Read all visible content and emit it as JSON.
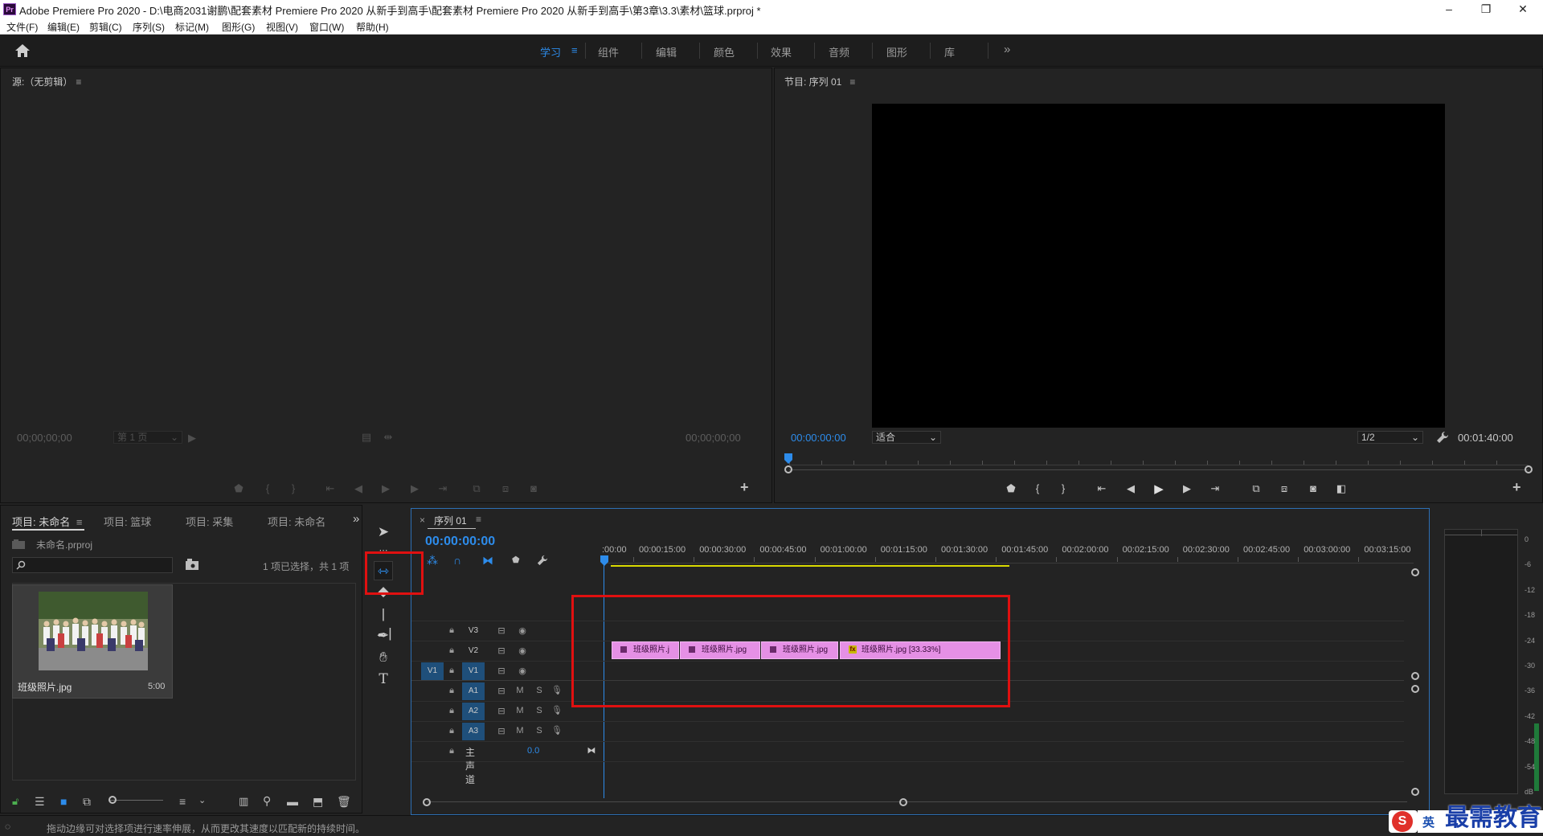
{
  "window": {
    "logo": "Pr",
    "title": "Adobe Premiere Pro 2020 - D:\\电商2031谢鹏\\配套素材 Premiere Pro 2020 从新手到高手\\配套素材 Premiere Pro 2020 从新手到高手\\第3章\\3.3\\素材\\篮球.prproj *",
    "minimize": "–",
    "restore": "❐",
    "close": "✕"
  },
  "menu": [
    "文件(F)",
    "编辑(E)",
    "剪辑(C)",
    "序列(S)",
    "标记(M)",
    "图形(G)",
    "视图(V)",
    "窗口(W)",
    "帮助(H)"
  ],
  "workspaces": {
    "items": [
      "学习",
      "组件",
      "编辑",
      "颜色",
      "效果",
      "音频",
      "图形",
      "库"
    ],
    "active": "学习",
    "menu_glyph": "≡",
    "more": "»"
  },
  "source": {
    "title": "源:（无剪辑）",
    "menu_glyph": "≡",
    "timecode_left": "00;00;00;00",
    "page_select": "第 1 页",
    "timecode_right": "00;00;00;00"
  },
  "program": {
    "title": "节目: 序列 01",
    "menu_glyph": "≡",
    "timecode": "00:00:00:00",
    "fit": "适合",
    "resolution": "1/2",
    "duration": "00:01:40:00"
  },
  "project": {
    "tabs": [
      "项目: 未命名",
      "项目: 篮球",
      "项目: 采集",
      "项目: 未命名"
    ],
    "menu_glyph": "≡",
    "more": "»",
    "file": "未命名.prproj",
    "selection_info": "1 项已选择，共 1 项",
    "item_name": "班级照片.jpg",
    "item_duration": "5:00"
  },
  "timeline": {
    "tab_close": "×",
    "title": "序列 01",
    "menu_glyph": "≡",
    "timecode": "00:00:00:00",
    "ruler": ":00:00",
    "ruler_labels": [
      "00:00:15:00",
      "00:00:30:00",
      "00:00:45:00",
      "00:01:00:00",
      "00:01:15:00",
      "00:01:30:00",
      "00:01:45:00",
      "00:02:00:00",
      "00:02:15:00",
      "00:02:30:00",
      "00:02:45:00",
      "00:03:00:00",
      "00:03:15:00"
    ],
    "video_tracks": [
      "V3",
      "V2",
      "V1"
    ],
    "source_patch_v": "V1",
    "audio_tracks": [
      "A1",
      "A2",
      "A3"
    ],
    "mute": "M",
    "solo": "S",
    "master": "主声道",
    "master_value": "0.0",
    "clips": [
      {
        "label": "班级照片.j"
      },
      {
        "label": "班级照片.jpg"
      },
      {
        "label": "班级照片.jpg"
      },
      {
        "label": "班级照片.jpg [33.33%]"
      }
    ]
  },
  "meter": {
    "scale": [
      "0",
      "-6",
      "-12",
      "-18",
      "-24",
      "-30",
      "-36",
      "-42",
      "-48",
      "-54",
      "dB"
    ]
  },
  "status": {
    "text": "拖动边缘可对选择项进行速率伸展，从而更改其速度以匹配新的持续时间。"
  },
  "watermark": {
    "text": "最需教育",
    "ime": "英"
  },
  "colors": {
    "accent": "#2d8ceb",
    "clip": "#e590e5",
    "highlight": "#e01010",
    "work_area": "#d9d900"
  }
}
